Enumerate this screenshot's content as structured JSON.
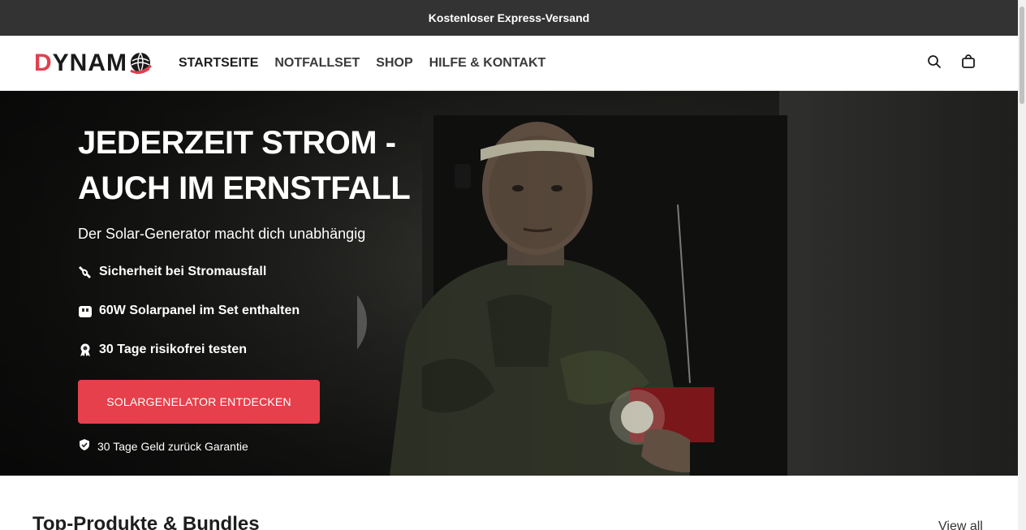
{
  "announcement": {
    "text": "Kostenloser Express-Versand"
  },
  "logo": {
    "first_letter": "D",
    "rest": "YNAM"
  },
  "nav": {
    "items": [
      {
        "label": "STARTSEITE"
      },
      {
        "label": "NOTFALLSET"
      },
      {
        "label": "SHOP"
      },
      {
        "label": "HILFE & KONTAKT"
      }
    ]
  },
  "header_icons": {
    "search": "search-icon",
    "cart": "shopping-bag-icon"
  },
  "hero": {
    "title_line1": "JEDERZEIT STROM -",
    "title_line2": "AUCH IM ERNSTFALL",
    "subtitle": "Der Solar-Generator macht dich unabhängig",
    "features": [
      {
        "icon": "plug-icon",
        "text": "Sicherheit bei Stromausfall"
      },
      {
        "icon": "battery-icon",
        "text": "60W Solarpanel im Set enthalten"
      },
      {
        "icon": "award-icon",
        "text": "30 Tage risikofrei testen"
      }
    ],
    "cta_label": "SOLARGENELATOR ENTDECKEN",
    "guarantee": {
      "icon": "shield-check-icon",
      "text": "30 Tage Geld zurück Garantie"
    }
  },
  "products": {
    "title": "Top-Produkte & Bundles",
    "view_all": "View all"
  },
  "colors": {
    "accent": "#e5404b",
    "announcement_bg": "#333333",
    "logo_accent": "#e04050"
  }
}
